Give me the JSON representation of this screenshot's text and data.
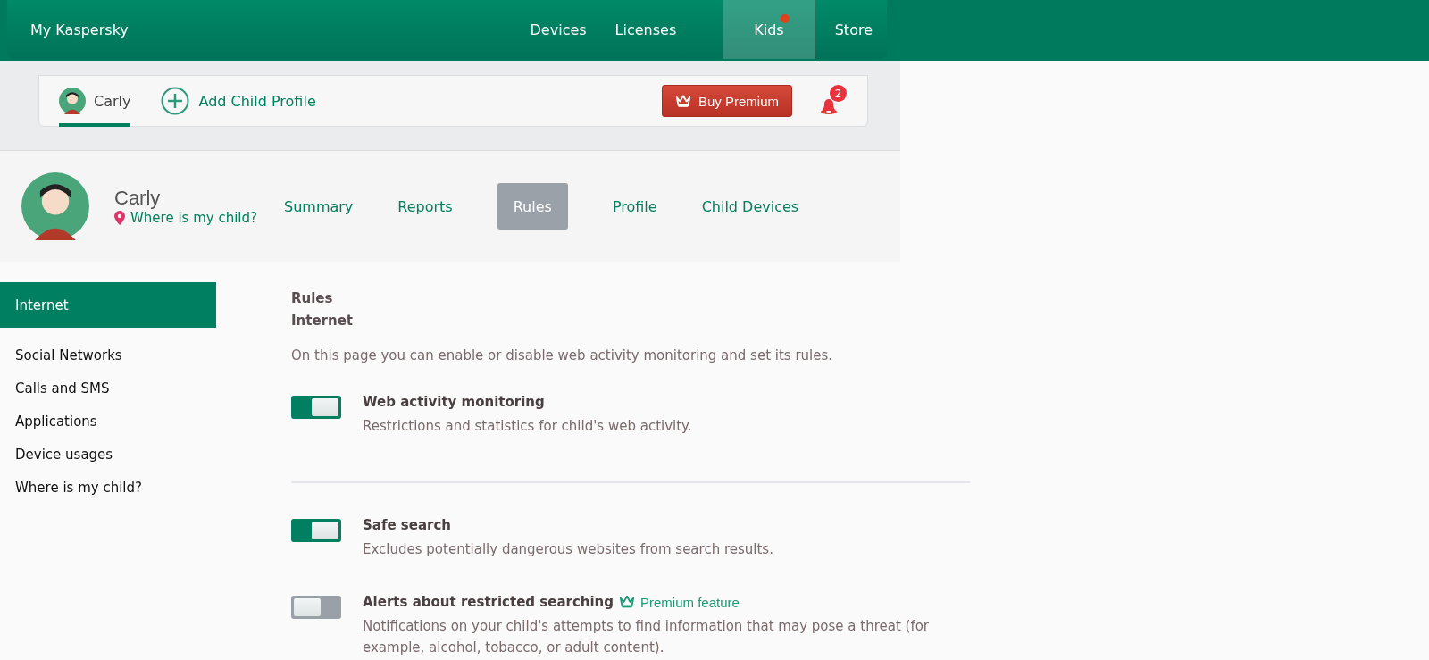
{
  "top_nav": {
    "brand": "My Kaspersky",
    "items": [
      {
        "label": "Devices",
        "selected": false,
        "dot": false
      },
      {
        "label": "Licenses",
        "selected": false,
        "dot": false
      },
      {
        "label": "Kids",
        "selected": true,
        "dot": true
      },
      {
        "label": "Store",
        "selected": false,
        "dot": false
      }
    ]
  },
  "child_bar": {
    "profiles": [
      {
        "name": "Carly",
        "selected": true
      }
    ],
    "add_profile": "Add Child Profile",
    "buy_premium": "Buy Premium",
    "notification_count": "2"
  },
  "child_header": {
    "name": "Carly",
    "location_link": "Where is my child?",
    "tabs": [
      {
        "label": "Summary",
        "selected": false
      },
      {
        "label": "Reports",
        "selected": false
      },
      {
        "label": "Rules",
        "selected": true
      },
      {
        "label": "Profile",
        "selected": false
      },
      {
        "label": "Child Devices",
        "selected": false
      }
    ]
  },
  "sidebar": {
    "items": [
      {
        "label": "Internet",
        "selected": true
      },
      {
        "label": "Social Networks",
        "selected": false
      },
      {
        "label": "Calls and SMS",
        "selected": false
      },
      {
        "label": "Applications",
        "selected": false
      },
      {
        "label": "Device usages",
        "selected": false
      },
      {
        "label": "Where is my child?",
        "selected": false
      }
    ]
  },
  "content": {
    "breadcrumb": [
      "Rules",
      "Internet"
    ],
    "intro": "On this page you can enable or disable web activity monitoring and set its rules.",
    "settings": [
      {
        "title": "Web activity monitoring",
        "description": "Restrictions and statistics for child's web activity.",
        "on": true,
        "divider_after": true
      },
      {
        "title": "Safe search",
        "description": "Excludes potentially dangerous websites from search results.",
        "on": true,
        "divider_after": false
      },
      {
        "title": "Alerts about restricted searching",
        "premium_label": "Premium feature",
        "description": "Notifications on your child's attempts to find information that may pose a threat (for example, alcohol, tobacco, or adult content).",
        "on": false,
        "divider_after": false
      }
    ]
  }
}
